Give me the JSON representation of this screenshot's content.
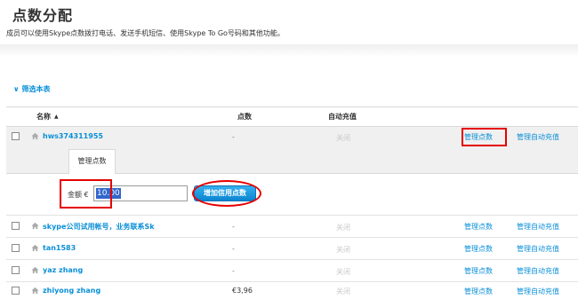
{
  "page": {
    "title": "点数分配",
    "description": "成员可以使用Skype点数拨打电话、发送手机短信、使用Skype To Go号码和其他功能。"
  },
  "filter": {
    "label": "筛选本表"
  },
  "table": {
    "headers": {
      "name": "名称",
      "credit": "点数",
      "auto_recharge": "自动充值"
    },
    "rows": [
      {
        "name": "hws374311955",
        "credit": "-",
        "auto": "关闭",
        "manage": "管理点数",
        "auto_link": "管理自动充值"
      },
      {
        "name": "skype公司试用帐号，业务联系Sk",
        "credit": "-",
        "auto": "关闭",
        "manage": "管理点数",
        "auto_link": "管理自动充值"
      },
      {
        "name": "tan1583",
        "credit": "-",
        "auto": "关闭",
        "manage": "管理点数",
        "auto_link": "管理自动充值"
      },
      {
        "name": "yaz zhang",
        "credit": "-",
        "auto": "关闭",
        "manage": "管理点数",
        "auto_link": "管理自动充值"
      },
      {
        "name": "zhiyong zhang",
        "credit": "€3,96",
        "auto": "关闭",
        "manage": "管理点数",
        "auto_link": "管理自动充值"
      }
    ]
  },
  "expanded": {
    "tab_label": "管理点数",
    "amount_label": "金额 €",
    "amount_value": "10.00",
    "add_button": "增加信用点数"
  },
  "colors": {
    "link": "#0a8fd8",
    "highlight": "#e60000",
    "button": "#0b84cf"
  }
}
